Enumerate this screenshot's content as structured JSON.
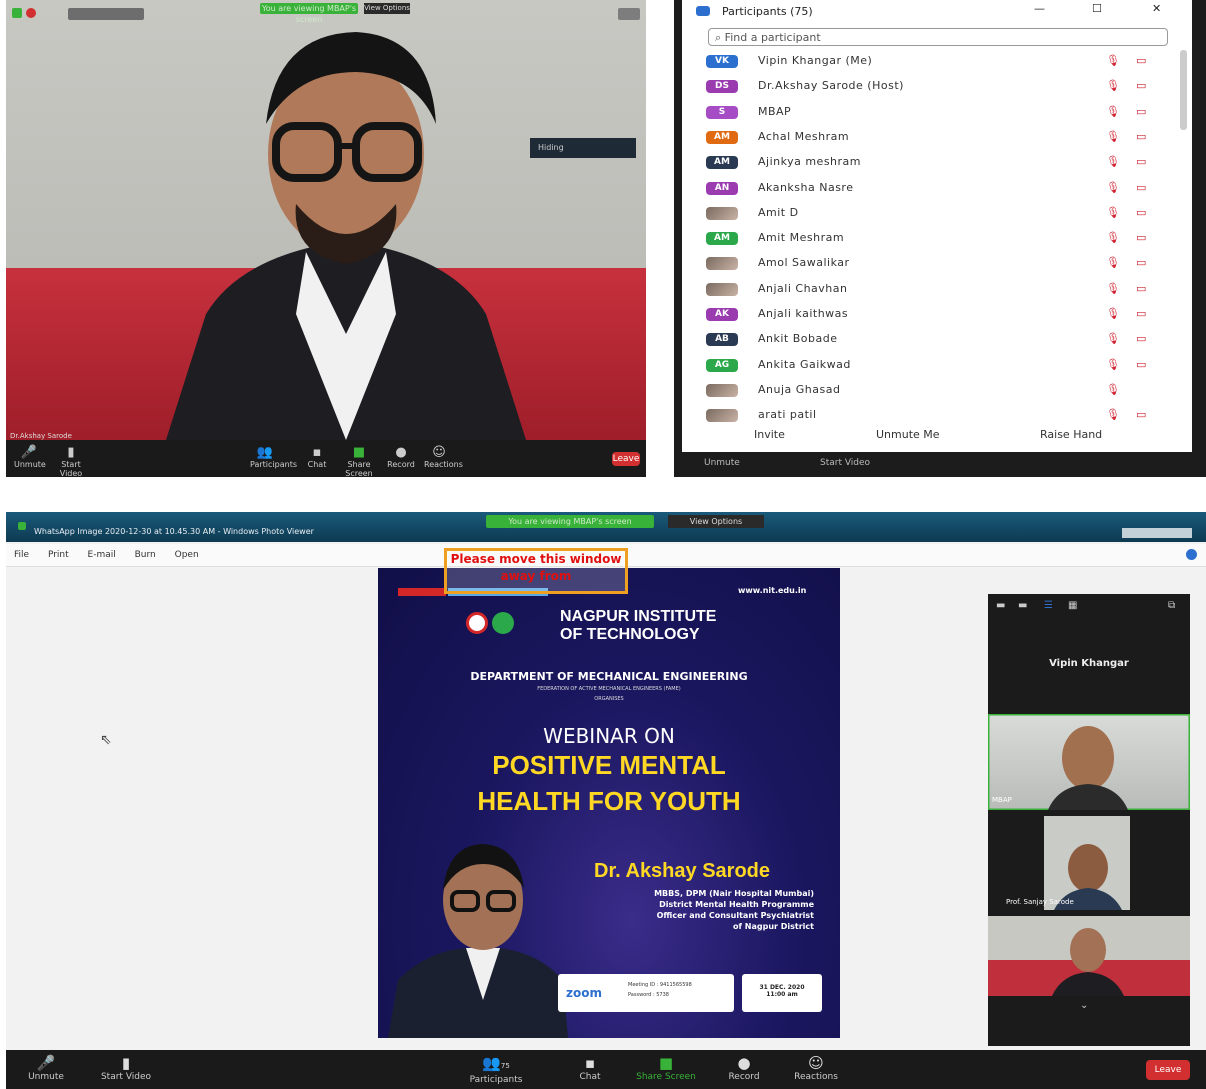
{
  "top_left": {
    "green_banner": "You are viewing MBAP's screen",
    "view_options": "View Options",
    "name_tag": "Dr.Akshay Sarode",
    "hover_label": "Hiding",
    "toolbar": [
      "Unmute",
      "Start Video",
      "Participants",
      "Chat",
      "Share Screen",
      "Record",
      "Reactions"
    ],
    "leave": "Leave"
  },
  "participants": {
    "title": "Participants (75)",
    "search_placeholder": "Find a participant",
    "rows": [
      {
        "initials": "VK",
        "name": "Vipin Khangar (Me)",
        "color": "#2d6fcf"
      },
      {
        "initials": "DS",
        "name": "Dr.Akshay Sarode (Host)",
        "color": "#9b3bb0"
      },
      {
        "initials": "S",
        "name": "MBAP",
        "color": "#a64cc4"
      },
      {
        "initials": "AM",
        "name": "Achal Meshram",
        "color": "#e06a12"
      },
      {
        "initials": "AM",
        "name": "Ajinkya meshram",
        "color": "#2a3a52"
      },
      {
        "initials": "AN",
        "name": "Akanksha Nasre",
        "color": "#9b3bb0"
      },
      {
        "initials": "",
        "name": "Amit D",
        "color": ""
      },
      {
        "initials": "AM",
        "name": "Amit Meshram",
        "color": "#2aa84a"
      },
      {
        "initials": "",
        "name": "Amol Sawalikar",
        "color": ""
      },
      {
        "initials": "",
        "name": "Anjali Chavhan",
        "color": ""
      },
      {
        "initials": "AK",
        "name": "Anjali kaithwas",
        "color": "#9b3bb0"
      },
      {
        "initials": "AB",
        "name": "Ankit Bobade",
        "color": "#2a3a52"
      },
      {
        "initials": "AG",
        "name": "Ankita Gaikwad",
        "color": "#2aa84a"
      },
      {
        "initials": "",
        "name": "Anuja Ghasad",
        "color": ""
      },
      {
        "initials": "",
        "name": "arati patil",
        "color": ""
      }
    ],
    "footer": {
      "invite": "Invite",
      "unmute_me": "Unmute Me",
      "raise_hand": "Raise Hand"
    },
    "behind_toolbar": [
      "Unmute",
      "Start Video"
    ]
  },
  "bottom": {
    "green_banner": "You are viewing MBAP's screen",
    "view_options": "View Options",
    "window_title": "WhatsApp Image 2020-12-30 at 10.45.30 AM - Windows Photo Viewer",
    "menu": [
      "File",
      "Print",
      "E-mail",
      "Burn",
      "Open"
    ],
    "warning": "Please move this window away from",
    "poster": {
      "website": "www.nit.edu.in",
      "institute_line1": "NAGPUR INSTITUTE",
      "institute_line2": "OF TECHNOLOGY",
      "department": "DEPARTMENT OF MECHANICAL ENGINEERING",
      "federation": "FEDERATION OF ACTIVE MECHANICAL ENGINEERS (FAME)",
      "organises": "ORGANISES",
      "webinar_on": "WEBINAR ON",
      "topic_line1": "POSITIVE MENTAL",
      "topic_line2": "HEALTH FOR YOUTH",
      "speaker": "Dr. Akshay Sarode",
      "speaker_info": [
        "MBBS, DPM (Nair Hospital Mumbai)",
        "District Mental Health Programme",
        "Officer and Consultant Psychiatrist",
        "of Nagpur District"
      ],
      "zoom": "zoom",
      "meeting_id": "Meeting ID : 9411565598",
      "password": "Password : 5738",
      "date": "31 DEC. 2020",
      "time": "11:00 am"
    },
    "gallery": {
      "name": "Vipin Khangar",
      "tile1": "MBAP",
      "tile2": "Prof. Sanjay Sarode"
    },
    "toolbar": [
      "Unmute",
      "Start Video",
      "Participants",
      "Chat",
      "Share Screen",
      "Record",
      "Reactions"
    ],
    "participants_count": "75",
    "leave": "Leave"
  }
}
